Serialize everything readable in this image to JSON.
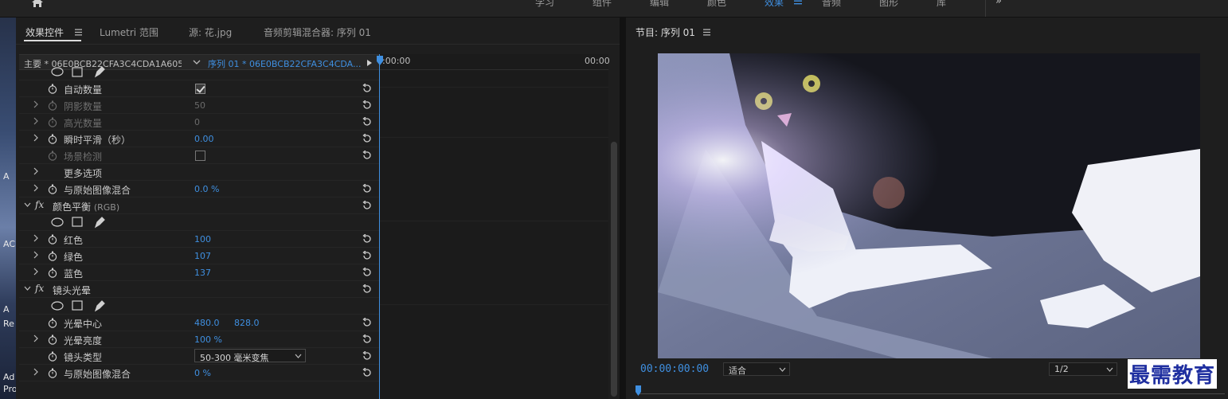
{
  "workspace_bar": {
    "tabs": [
      "学习",
      "组件",
      "编辑",
      "颜色",
      "效果",
      "音频",
      "图形",
      "库"
    ],
    "active_tab": "效果",
    "more": "»"
  },
  "desktop_strip": {
    "labels": [
      "A",
      "AC",
      "A",
      "Re",
      "Ad",
      "Pro"
    ]
  },
  "effect_controls": {
    "tabs": [
      {
        "label": "效果控件"
      },
      {
        "label": "Lumetri 范围"
      },
      {
        "label": "源: 花.jpg"
      },
      {
        "label": "音频剪辑混合器: 序列 01"
      }
    ],
    "master_clip": "主要 * 06E0BCB22CFA3C4CDA1A6056...",
    "sequence_clip": "序列 01 * 06E0BCB22CFA3C4CDA...",
    "timeline_start": ":00:00",
    "timeline_end": "00:00",
    "rows": {
      "auto_amount": {
        "label": "自动数量"
      },
      "shadow_amount": {
        "label": "阴影数量",
        "value": "50"
      },
      "highlight_amount": {
        "label": "高光数量",
        "value": "0"
      },
      "temporal_smoothing": {
        "label": "瞬时平滑（秒）",
        "value": "0.00"
      },
      "scene_detect": {
        "label": "场景检测"
      },
      "more_options": {
        "label": "更多选项"
      },
      "blend_original_1": {
        "label": "与原始图像混合",
        "value": "0.0 %"
      },
      "color_balance": {
        "label": "颜色平衡",
        "suffix": "(RGB)"
      },
      "red": {
        "label": "红色",
        "value": "100"
      },
      "green": {
        "label": "绿色",
        "value": "107"
      },
      "blue": {
        "label": "蓝色",
        "value": "137"
      },
      "lens_flare": {
        "label": "镜头光晕"
      },
      "flare_center": {
        "label": "光晕中心",
        "value_x": "480.0",
        "value_y": "828.0"
      },
      "flare_brightness": {
        "label": "光晕亮度",
        "value": "100 %"
      },
      "lens_type": {
        "label": "镜头类型",
        "value": "50-300 毫米变焦"
      },
      "blend_original_2": {
        "label": "与原始图像混合",
        "value": "0 %"
      }
    },
    "fx_badge": "fx"
  },
  "program_monitor": {
    "title": "节目: 序列 01",
    "timecode": "00:00:00:00",
    "fit_select": "适合",
    "resolution_select": "1/2"
  },
  "watermark": "最需教育",
  "colors": {
    "accent_blue": "#3f8fe0",
    "panel_bg": "#1e1e1e",
    "watermark_blue": "#1f2fa0"
  }
}
